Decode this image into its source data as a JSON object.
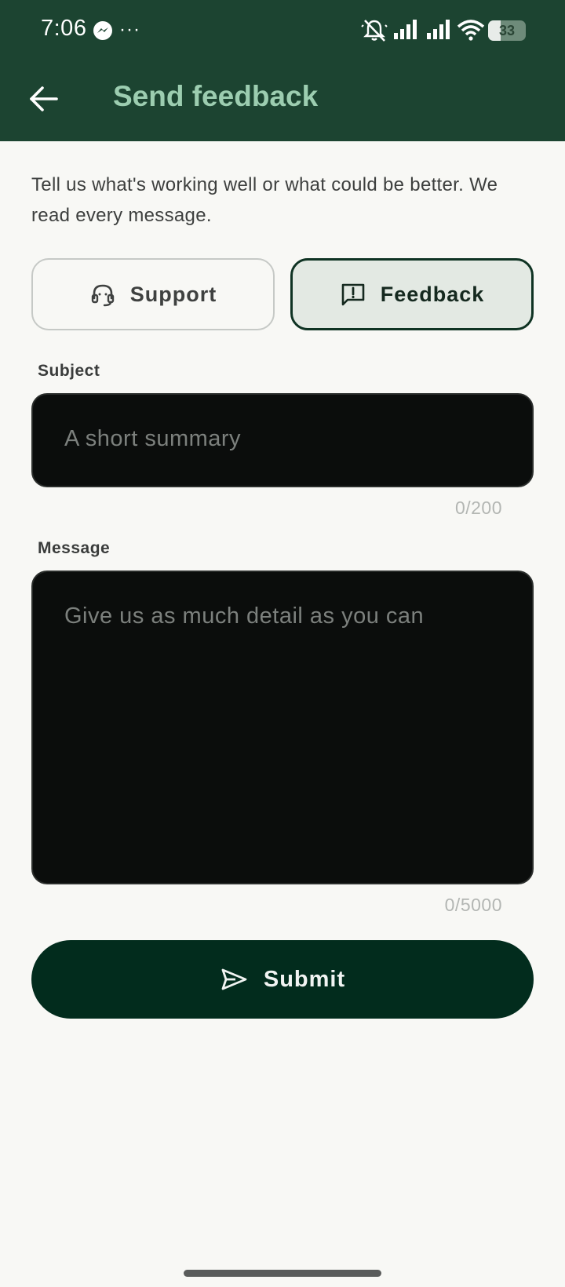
{
  "status_bar": {
    "time": "7:06",
    "overflow_dots": "···",
    "battery_level": "33",
    "battery_percent": 0.33
  },
  "header": {
    "title": "Send feedback",
    "background_color": "#1c4431",
    "title_color": "#9ccdb0"
  },
  "intro_text": "Tell us what's working well or what could be better. We read every message.",
  "segments": {
    "support_label": "Support",
    "support_icon": "headset-icon",
    "feedback_label": "Feedback",
    "feedback_icon": "feedback-bubble-icon",
    "selected": "Feedback"
  },
  "subject": {
    "label": "Subject",
    "placeholder": "A short summary",
    "value": "",
    "counter": "0/200"
  },
  "message": {
    "label": "Message",
    "placeholder": "Give us as much detail as you can",
    "value": "",
    "counter": "0/5000"
  },
  "submit": {
    "label": "Submit",
    "icon": "send-icon",
    "color": "#022c1d"
  }
}
